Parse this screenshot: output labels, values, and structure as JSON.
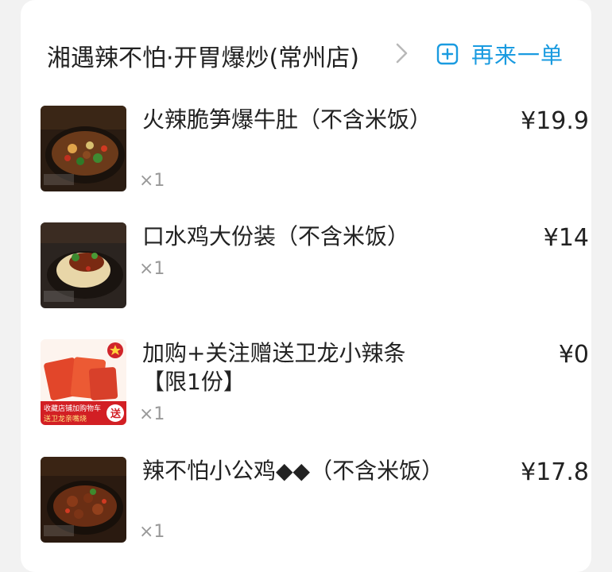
{
  "store": {
    "name": "湘遇辣不怕·开胃爆炒(常州店)",
    "chevron_icon": "chevron-right-icon"
  },
  "reorder": {
    "label": "再来一单",
    "icon": "plus-square-icon",
    "color": "#1a9be0"
  },
  "items": [
    {
      "name": "火辣脆笋爆牛肚（不含米饭）",
      "qty": "×1",
      "price": "¥19.9"
    },
    {
      "name": "口水鸡大份装（不含米饭）",
      "qty": "×1",
      "price": "¥14"
    },
    {
      "name": "加购+关注赠送卫龙小辣条【限1份】",
      "qty": "×1",
      "price": "¥0",
      "image_caption_line1": "收藏店铺加购物车",
      "image_caption_line2": "送卫龙亲嘴烧",
      "image_badge": "送"
    },
    {
      "name": "辣不怕小公鸡◆◆（不含米饭）",
      "qty": "×1",
      "price": "¥17.8"
    }
  ]
}
